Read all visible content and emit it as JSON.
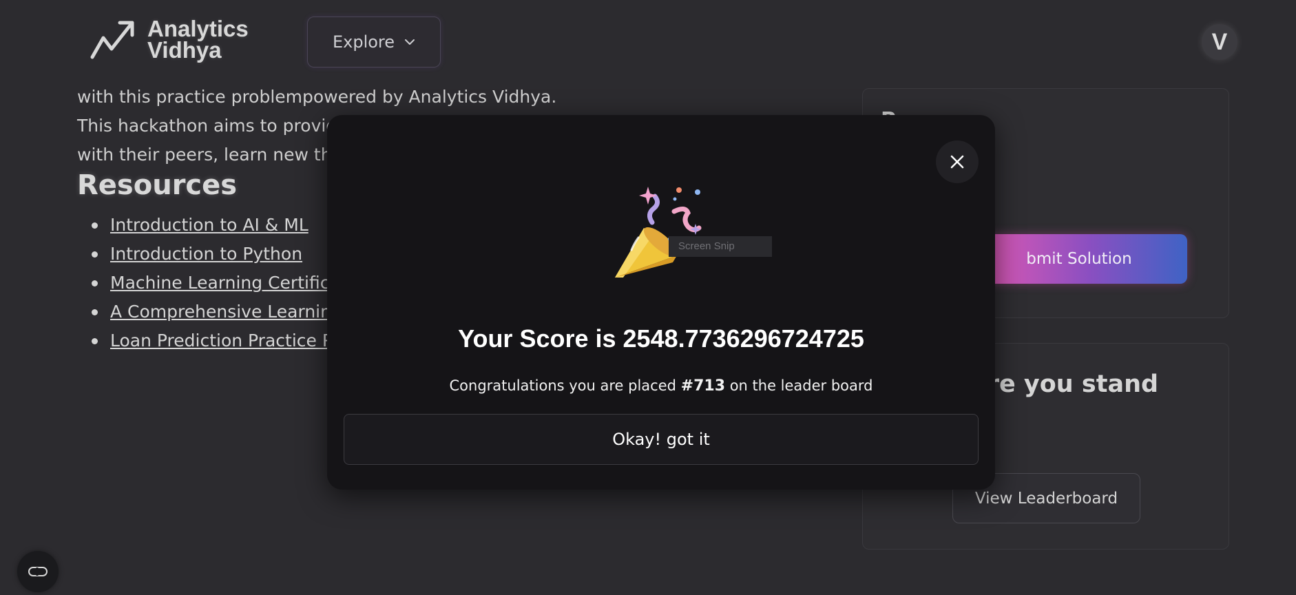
{
  "header": {
    "logo_line1": "Analytics",
    "logo_line2": "Vidhya",
    "explore_label": "Explore",
    "avatar_initial": "V"
  },
  "background": {
    "intro_lines": [
      "with this practice problempowered by Analytics Vidhya.",
      "This hackathon aims to provid",
      "with their peers, learn new thi"
    ],
    "resources_title": "Resources",
    "resources": [
      "Introduction to AI & ML",
      "Introduction to Python",
      "Machine Learning Certific",
      "A Comprehensive Learnin",
      "Loan Prediction Practice P"
    ],
    "card_title": "P",
    "submit_label": "bmit Solution",
    "stand_title": "ere you stand",
    "leaderboard_label": "View Leaderboard"
  },
  "modal": {
    "snip_text": "Screen Snip",
    "score_text": "Your Score is 2548.7736296724725",
    "congrats_prefix": "Congratulations you are placed",
    "rank": "#713",
    "congrats_suffix": "on the leader board",
    "okay_label": "Okay! got it"
  },
  "icons": {
    "logo": "trend-arrow-icon",
    "explore": "chevron-down-icon",
    "close": "close-icon",
    "celebration": "party-popper-icon",
    "chat": "chat-link-icon"
  },
  "colors": {
    "page_bg": "#2c2b2f",
    "modal_bg": "#151417",
    "submit_gradient_start": "#e85ab2",
    "submit_gradient_end": "#3f63c5"
  }
}
